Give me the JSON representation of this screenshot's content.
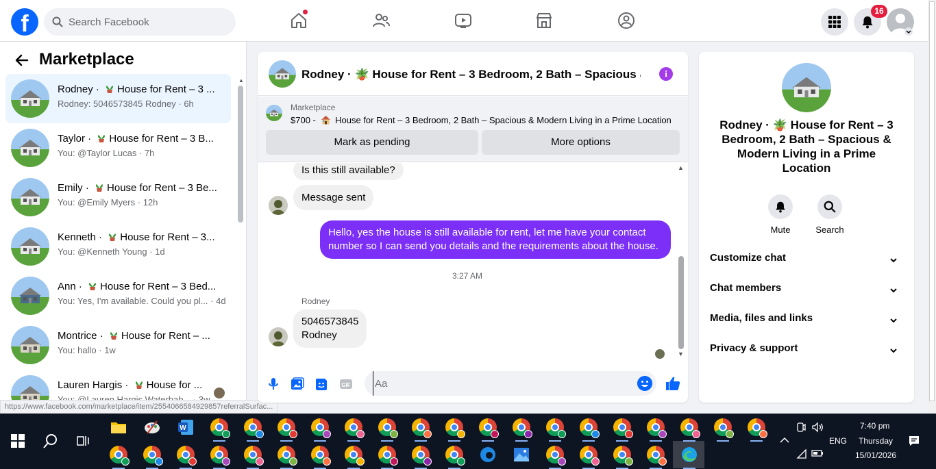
{
  "header": {
    "search_placeholder": "Search Facebook",
    "notifications_count": "16",
    "nav": [
      "home-icon",
      "friends-icon",
      "video-icon",
      "marketplace-icon",
      "groups-icon"
    ]
  },
  "sidebar": {
    "title": "Marketplace",
    "conversations": [
      {
        "name": "Rodney",
        "listing": "House for Rent – 3 ...",
        "snippet": "Rodney: 5046573845 Rodney",
        "time": "6h"
      },
      {
        "name": "Taylor",
        "listing": "House for Rent – 3 B...",
        "snippet": "You: @Taylor Lucas",
        "time": "7h"
      },
      {
        "name": "Emily",
        "listing": "House for Rent – 3 Be...",
        "snippet": "You: @Emily Myers",
        "time": "12h"
      },
      {
        "name": "Kenneth",
        "listing": "House for Rent – 3...",
        "snippet": "You: @Kenneth Young",
        "time": "1d"
      },
      {
        "name": "Ann",
        "listing": "House for Rent – 3 Bed...",
        "snippet": "You: Yes, I'm available. Could you pl...",
        "time": "4d"
      },
      {
        "name": "Montrice",
        "listing": "House for Rent – ...",
        "snippet": "You: hallo",
        "time": "1w"
      },
      {
        "name": "Lauren Hargis",
        "listing": "House for ...",
        "snippet": "You: @Lauren Hargis Waterbab...",
        "time": "3w"
      }
    ]
  },
  "status_url": "https://www.facebook.com/marketplace/item/2554066584929857referralSurfac...",
  "chat": {
    "title": "Rodney · 🪴 House for Rent – 3 Bedroom, 2 Bath – Spacious & ...",
    "marketplace_label": "Marketplace",
    "listing_price": "$700 -",
    "listing_title": "House for Rent – 3 Bedroom, 2 Bath – Spacious & Modern Living in a Prime Location",
    "pending_button": "Mark as pending",
    "more_options_button": "More options",
    "messages": {
      "msg1": "Is this still available?",
      "msg2": "Message sent",
      "msg3": "Hello, yes the house is still available for rent, let me have your contact number so I can send you details and the requirements about the house.",
      "timestamp": "3:27 AM",
      "sender": "Rodney",
      "msg4_line1": "5046573845",
      "msg4_line2": "Rodney"
    },
    "composer_placeholder": "Aa"
  },
  "details": {
    "title": "Rodney · 🪴 House for Rent – 3 Bedroom, 2 Bath – Spacious & Modern Living in a Prime Location",
    "mute": "Mute",
    "search": "Search",
    "sections": [
      "Customize chat",
      "Chat members",
      "Media, files and links",
      "Privacy & support"
    ]
  },
  "taskbar": {
    "lang": "ENG",
    "time": "7:40 pm",
    "day": "Thursday",
    "date": "15/01/2026"
  },
  "colors": {
    "brand": "#0866ff",
    "outgoing_bubble": "#7b2ff7",
    "badge": "#e41e3f"
  }
}
